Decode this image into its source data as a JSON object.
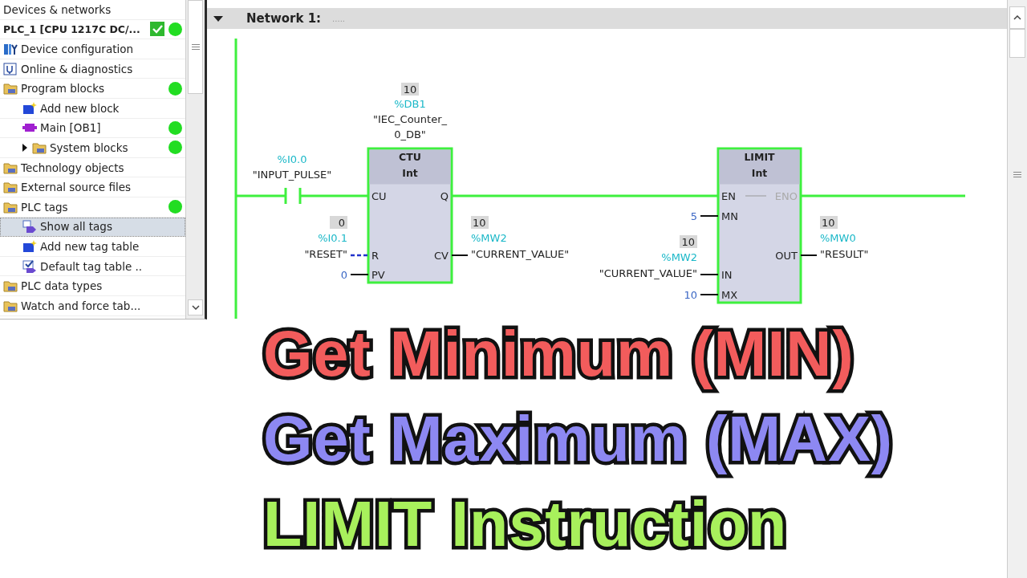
{
  "project_tree": [
    {
      "label": "Devices & networks",
      "kind": "link"
    },
    {
      "label": "PLC_1 [CPU 1217C DC/...",
      "kind": "plc",
      "checked": true,
      "online": true,
      "expanded": true,
      "children": [
        {
          "label": "Device configuration",
          "kind": "device",
          "online": false
        },
        {
          "label": "Online & diagnostics",
          "kind": "diag",
          "online": false
        },
        {
          "label": "Program blocks",
          "kind": "folder",
          "online": true,
          "expanded": true,
          "children": [
            {
              "label": "Add new block",
              "kind": "add",
              "online": false
            },
            {
              "label": "Main [OB1]",
              "kind": "block",
              "online": true
            },
            {
              "label": "System blocks",
              "kind": "folder",
              "online": true,
              "expanded": false
            }
          ]
        },
        {
          "label": "Technology objects",
          "kind": "folder",
          "online": false
        },
        {
          "label": "External source files",
          "kind": "folder",
          "online": false
        },
        {
          "label": "PLC tags",
          "kind": "folder",
          "online": true,
          "expanded": true,
          "children": [
            {
              "label": "Show all tags",
              "kind": "tags",
              "online": false,
              "selected": true
            },
            {
              "label": "Add new tag table",
              "kind": "add",
              "online": false,
              "selected": false
            },
            {
              "label": "Default tag table ..",
              "kind": "table",
              "online": false,
              "selected": false
            }
          ]
        },
        {
          "label": "PLC data types",
          "kind": "folder",
          "online": false
        },
        {
          "label": "Watch and force tab...",
          "kind": "folder",
          "online": false
        }
      ]
    }
  ],
  "network": {
    "title": "Network 1:",
    "comment": ".....",
    "expanded": true
  },
  "contact": {
    "address": "%I0.0",
    "tag": "\"INPUT_PULSE\""
  },
  "blocks": [
    {
      "instance": {
        "value": "10",
        "address": "%DB1",
        "tag_lines": [
          "\"IEC_Counter_",
          "0_DB\""
        ]
      },
      "name": "CTU",
      "datatype": "Int",
      "inputs": [
        {
          "pin": "CU",
          "kind": "power"
        },
        {
          "pin": "R",
          "kind": "param_dashed",
          "param": {
            "value": "0",
            "address": "%I0.1",
            "tag": "\"RESET\""
          }
        },
        {
          "pin": "PV",
          "kind": "constant",
          "param": {
            "constant": "0"
          }
        }
      ],
      "outputs": [
        {
          "pin": "Q",
          "kind": "power"
        },
        {
          "pin": "CV",
          "kind": "param",
          "param": {
            "value": "10",
            "address": "%MW2",
            "tag": "\"CURRENT_VALUE\""
          }
        }
      ]
    },
    {
      "name": "LIMIT",
      "datatype": "Int",
      "inputs": [
        {
          "pin": "EN",
          "kind": "power"
        },
        {
          "pin": "MN",
          "kind": "constant",
          "param": {
            "constant": "5"
          }
        },
        {
          "pin": "IN",
          "kind": "param",
          "param": {
            "value": "10",
            "address": "%MW2",
            "tag": "\"CURRENT_VALUE\""
          }
        },
        {
          "pin": "MX",
          "kind": "constant",
          "param": {
            "constant": "10"
          }
        }
      ],
      "outputs": [
        {
          "pin": "ENO",
          "kind": "power",
          "disabled": true
        },
        {
          "pin": "OUT",
          "kind": "param",
          "param": {
            "value": "10",
            "address": "%MW0",
            "tag": "\"RESULT\""
          }
        }
      ]
    }
  ],
  "headline": [
    {
      "text": "Get Minimum (MIN)",
      "color": "#f25c5c"
    },
    {
      "text": "Get Maximum (MAX)",
      "color": "#8d88f2"
    },
    {
      "text": "LIMIT Instruction",
      "color": "#a8f05c"
    }
  ]
}
